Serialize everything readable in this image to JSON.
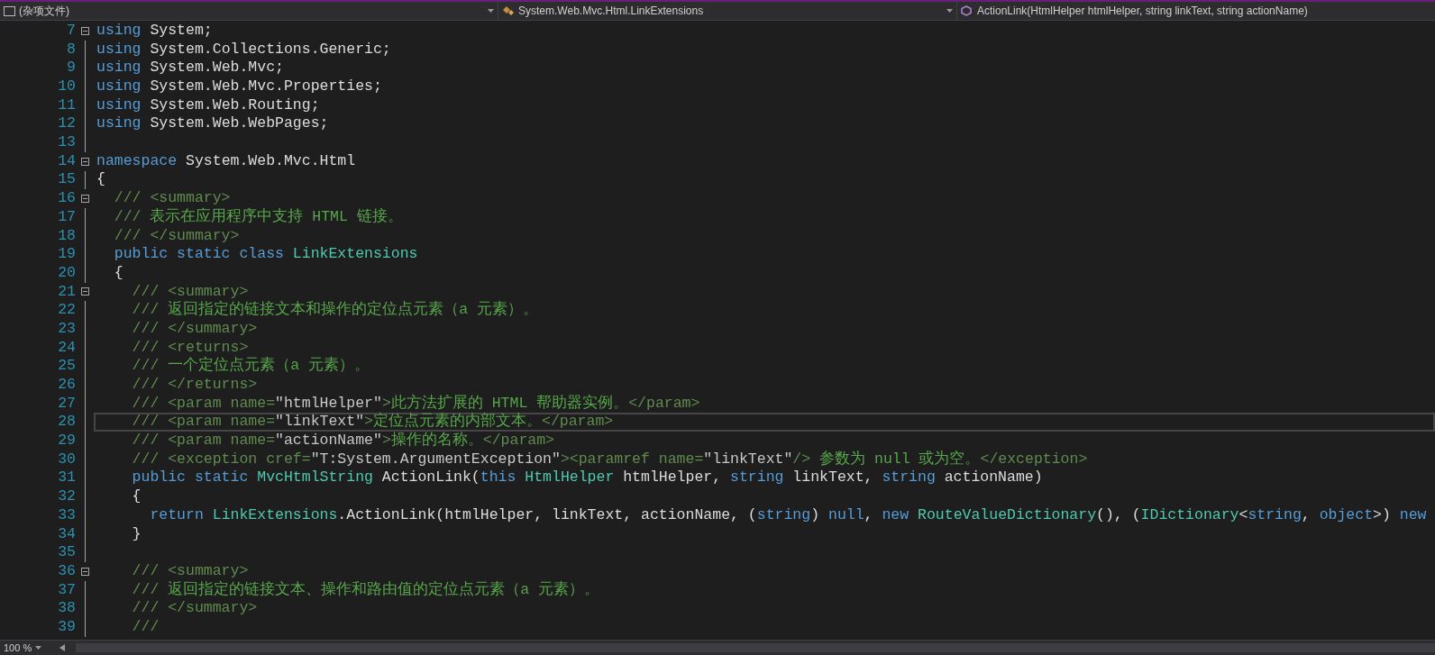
{
  "navigation_bar": {
    "project": "(杂项文件)",
    "type": "System.Web.Mvc.Html.LinkExtensions",
    "member": "ActionLink(HtmlHelper htmlHelper, string linkText, string actionName)"
  },
  "lines": [
    {
      "number": "7",
      "fold": true,
      "current": false,
      "tokens": [
        {
          "kind": "keyword",
          "text": "using"
        },
        {
          "kind": "plain",
          "text": " System;"
        }
      ]
    },
    {
      "number": "8",
      "fold": false,
      "current": false,
      "tokens": [
        {
          "kind": "keyword",
          "text": "using"
        },
        {
          "kind": "plain",
          "text": " System.Collections.Generic;"
        }
      ]
    },
    {
      "number": "9",
      "fold": false,
      "current": false,
      "tokens": [
        {
          "kind": "keyword",
          "text": "using"
        },
        {
          "kind": "plain",
          "text": " System.Web.Mvc;"
        }
      ]
    },
    {
      "number": "10",
      "fold": false,
      "current": false,
      "tokens": [
        {
          "kind": "keyword",
          "text": "using"
        },
        {
          "kind": "plain",
          "text": " System.Web.Mvc.Properties;"
        }
      ]
    },
    {
      "number": "11",
      "fold": false,
      "current": false,
      "tokens": [
        {
          "kind": "keyword",
          "text": "using"
        },
        {
          "kind": "plain",
          "text": " System.Web.Routing;"
        }
      ]
    },
    {
      "number": "12",
      "fold": false,
      "current": false,
      "tokens": [
        {
          "kind": "keyword",
          "text": "using"
        },
        {
          "kind": "plain",
          "text": " System.Web.WebPages;"
        }
      ]
    },
    {
      "number": "13",
      "fold": false,
      "current": false
    },
    {
      "number": "14",
      "fold": true,
      "current": false,
      "tokens": [
        {
          "kind": "keyword",
          "text": "namespace"
        },
        {
          "kind": "plain",
          "text": " System.Web.Mvc.Html"
        }
      ]
    },
    {
      "number": "15",
      "fold": false,
      "current": false,
      "tokens": [
        {
          "kind": "plain",
          "text": "{"
        }
      ]
    },
    {
      "number": "16",
      "fold": true,
      "current": false,
      "tokens": [
        {
          "kind": "doc-delim",
          "text": "  /// <summary>"
        }
      ]
    },
    {
      "number": "17",
      "fold": false,
      "current": false,
      "tokens": [
        {
          "kind": "doc-delim",
          "text": "  ///"
        },
        {
          "kind": "doc-text",
          "text": " 表示在应用程序中支持 HTML 链接。"
        }
      ]
    },
    {
      "number": "18",
      "fold": false,
      "current": false,
      "tokens": [
        {
          "kind": "doc-delim",
          "text": "  /// </summary>"
        }
      ]
    },
    {
      "number": "19",
      "fold": false,
      "current": false,
      "tokens": [
        {
          "kind": "keyword",
          "text": "  public static class"
        },
        {
          "kind": "type",
          "text": " LinkExtensions"
        }
      ]
    },
    {
      "number": "20",
      "fold": false,
      "current": false,
      "tokens": [
        {
          "kind": "plain",
          "text": "  {"
        }
      ]
    },
    {
      "number": "21",
      "fold": true,
      "current": false,
      "tokens": [
        {
          "kind": "doc-delim",
          "text": "    /// <summary>"
        }
      ]
    },
    {
      "number": "22",
      "fold": false,
      "current": false,
      "tokens": [
        {
          "kind": "doc-delim",
          "text": "    ///"
        },
        {
          "kind": "doc-text",
          "text": " 返回指定的链接文本和操作的定位点元素（a 元素）。"
        }
      ]
    },
    {
      "number": "23",
      "fold": false,
      "current": false,
      "tokens": [
        {
          "kind": "doc-delim",
          "text": "    /// </summary>"
        }
      ]
    },
    {
      "number": "24",
      "fold": false,
      "current": false,
      "tokens": [
        {
          "kind": "doc-delim",
          "text": "    /// <returns>"
        }
      ]
    },
    {
      "number": "25",
      "fold": false,
      "current": false,
      "tokens": [
        {
          "kind": "doc-delim",
          "text": "    ///"
        },
        {
          "kind": "doc-text",
          "text": " 一个定位点元素（a 元素）。"
        }
      ]
    },
    {
      "number": "26",
      "fold": false,
      "current": false,
      "tokens": [
        {
          "kind": "doc-delim",
          "text": "    /// </returns>"
        }
      ]
    },
    {
      "number": "27",
      "fold": false,
      "current": false,
      "tokens": [
        {
          "kind": "doc-delim",
          "text": "    /// <param name="
        },
        {
          "kind": "doc-value",
          "text": "\"htmlHelper\""
        },
        {
          "kind": "doc-delim",
          "text": ">"
        },
        {
          "kind": "doc-text",
          "text": "此方法扩展的 HTML 帮助器实例。"
        },
        {
          "kind": "doc-delim",
          "text": "</param>"
        }
      ]
    },
    {
      "number": "28",
      "fold": false,
      "current": true,
      "tokens": [
        {
          "kind": "doc-delim",
          "text": "    /// <param name="
        },
        {
          "kind": "doc-value",
          "text": "\"linkText\""
        },
        {
          "kind": "doc-delim",
          "text": ">"
        },
        {
          "kind": "doc-text",
          "text": "定位点元素的内部文本。"
        },
        {
          "kind": "doc-delim",
          "text": "</param>"
        }
      ]
    },
    {
      "number": "29",
      "fold": false,
      "current": false,
      "tokens": [
        {
          "kind": "doc-delim",
          "text": "    /// <param name="
        },
        {
          "kind": "doc-value",
          "text": "\"actionName\""
        },
        {
          "kind": "doc-delim",
          "text": ">"
        },
        {
          "kind": "doc-text",
          "text": "操作的名称。"
        },
        {
          "kind": "doc-delim",
          "text": "</param>"
        }
      ]
    },
    {
      "number": "30",
      "fold": false,
      "current": false,
      "tokens": [
        {
          "kind": "doc-delim",
          "text": "    /// <exception cref="
        },
        {
          "kind": "doc-value",
          "text": "\"T:System.ArgumentException\""
        },
        {
          "kind": "doc-delim",
          "text": "><paramref name="
        },
        {
          "kind": "doc-value",
          "text": "\"linkText\""
        },
        {
          "kind": "doc-delim",
          "text": "/>"
        },
        {
          "kind": "doc-text",
          "text": " 参数为 null 或为空。"
        },
        {
          "kind": "doc-delim",
          "text": "</exception>"
        }
      ]
    },
    {
      "number": "31",
      "fold": false,
      "current": false,
      "tokens": [
        {
          "kind": "keyword",
          "text": "    public static"
        },
        {
          "kind": "type",
          "text": " MvcHtmlString"
        },
        {
          "kind": "plain",
          "text": " ActionLink("
        },
        {
          "kind": "keyword",
          "text": "this"
        },
        {
          "kind": "type",
          "text": " HtmlHelper"
        },
        {
          "kind": "plain",
          "text": " htmlHelper, "
        },
        {
          "kind": "keyword",
          "text": "string"
        },
        {
          "kind": "plain",
          "text": " linkText, "
        },
        {
          "kind": "keyword",
          "text": "string"
        },
        {
          "kind": "plain",
          "text": " actionName)"
        }
      ]
    },
    {
      "number": "32",
      "fold": false,
      "current": false,
      "tokens": [
        {
          "kind": "plain",
          "text": "    {"
        }
      ]
    },
    {
      "number": "33",
      "fold": false,
      "current": false,
      "tokens": [
        {
          "kind": "keyword",
          "text": "      return"
        },
        {
          "kind": "type",
          "text": " LinkExtensions"
        },
        {
          "kind": "plain",
          "text": ".ActionLink(htmlHelper, linkText, actionName, ("
        },
        {
          "kind": "keyword",
          "text": "string"
        },
        {
          "kind": "plain",
          "text": ") "
        },
        {
          "kind": "keyword",
          "text": "null"
        },
        {
          "kind": "plain",
          "text": ", "
        },
        {
          "kind": "keyword",
          "text": "new"
        },
        {
          "kind": "type",
          "text": " RouteValueDictionary"
        },
        {
          "kind": "plain",
          "text": "(), ("
        },
        {
          "kind": "type",
          "text": "IDictionary"
        },
        {
          "kind": "plain",
          "text": "<"
        },
        {
          "kind": "keyword",
          "text": "string"
        },
        {
          "kind": "plain",
          "text": ", "
        },
        {
          "kind": "keyword",
          "text": "object"
        },
        {
          "kind": "plain",
          "text": ">) "
        },
        {
          "kind": "keyword",
          "text": "new"
        }
      ]
    },
    {
      "number": "34",
      "fold": false,
      "current": false,
      "tokens": [
        {
          "kind": "plain",
          "text": "    }"
        }
      ]
    },
    {
      "number": "35",
      "fold": false,
      "current": false
    },
    {
      "number": "36",
      "fold": true,
      "current": false,
      "tokens": [
        {
          "kind": "doc-delim",
          "text": "    /// <summary>"
        }
      ]
    },
    {
      "number": "37",
      "fold": false,
      "current": false,
      "tokens": [
        {
          "kind": "doc-delim",
          "text": "    ///"
        },
        {
          "kind": "doc-text",
          "text": " 返回指定的链接文本、操作和路由值的定位点元素（a 元素）。"
        }
      ]
    },
    {
      "number": "38",
      "fold": false,
      "current": false,
      "tokens": [
        {
          "kind": "doc-delim",
          "text": "    /// </summary>"
        }
      ]
    },
    {
      "number": "39",
      "fold": false,
      "current": false,
      "tokens": [
        {
          "kind": "doc-delim",
          "text": "    ///"
        }
      ]
    }
  ],
  "status_bar": {
    "zoom": "100 %"
  }
}
